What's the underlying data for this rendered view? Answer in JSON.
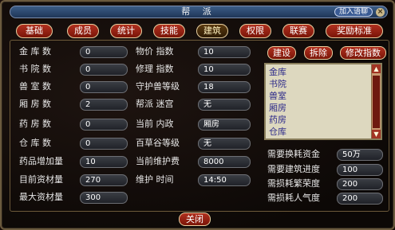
{
  "window": {
    "title": "帮 派",
    "join_channel": "加入语聊",
    "close_glyph": "×"
  },
  "tabs": [
    "基础",
    "成员",
    "统计",
    "技能",
    "建筑",
    "权限",
    "联赛",
    "奖励标准"
  ],
  "active_tab": "建筑",
  "left_stats": [
    {
      "label": "金  库  数",
      "value": "0"
    },
    {
      "label": "书  院  数",
      "value": "0"
    },
    {
      "label": "兽  室  数",
      "value": "0"
    },
    {
      "label": "厢  房  数",
      "value": "2"
    },
    {
      "label": "药  房  数",
      "value": "0"
    },
    {
      "label": "仓  库  数",
      "value": "0"
    },
    {
      "label": "药品增加量",
      "value": "10"
    },
    {
      "label": "目前资材量",
      "value": "270"
    },
    {
      "label": "最大资材量",
      "value": "300"
    }
  ],
  "mid_stats": [
    {
      "label": "物价  指数",
      "value": "10"
    },
    {
      "label": "修理  指数",
      "value": "10"
    },
    {
      "label": "守护兽等级",
      "value": "18"
    },
    {
      "label": "帮派  迷宫",
      "value": "无"
    },
    {
      "label": "当前  内政",
      "value": "厢房"
    },
    {
      "label": "百草谷等级",
      "value": "无"
    },
    {
      "label": "当前维护费",
      "value": "8000"
    },
    {
      "label": "维护  时间",
      "value": "14:50"
    }
  ],
  "building_actions": {
    "build": "建设",
    "demolish": "拆除",
    "modify_index": "修改指数"
  },
  "building_list": [
    "金库",
    "书院",
    "兽室",
    "厢房",
    "药房",
    "仓库"
  ],
  "requirements": [
    {
      "label": "需要换耗资金",
      "value": "50万"
    },
    {
      "label": "需要建筑进度",
      "value": "100"
    },
    {
      "label": "需损耗繁荣度",
      "value": "200"
    },
    {
      "label": "需损耗人气度",
      "value": "200"
    }
  ],
  "footer": {
    "close_label": "关闭"
  },
  "colors": {
    "tab_red": "#9a2414",
    "panel_border": "#6d5a3a",
    "list_bg": "#ddd8bf",
    "list_text": "#2d2a8a"
  }
}
